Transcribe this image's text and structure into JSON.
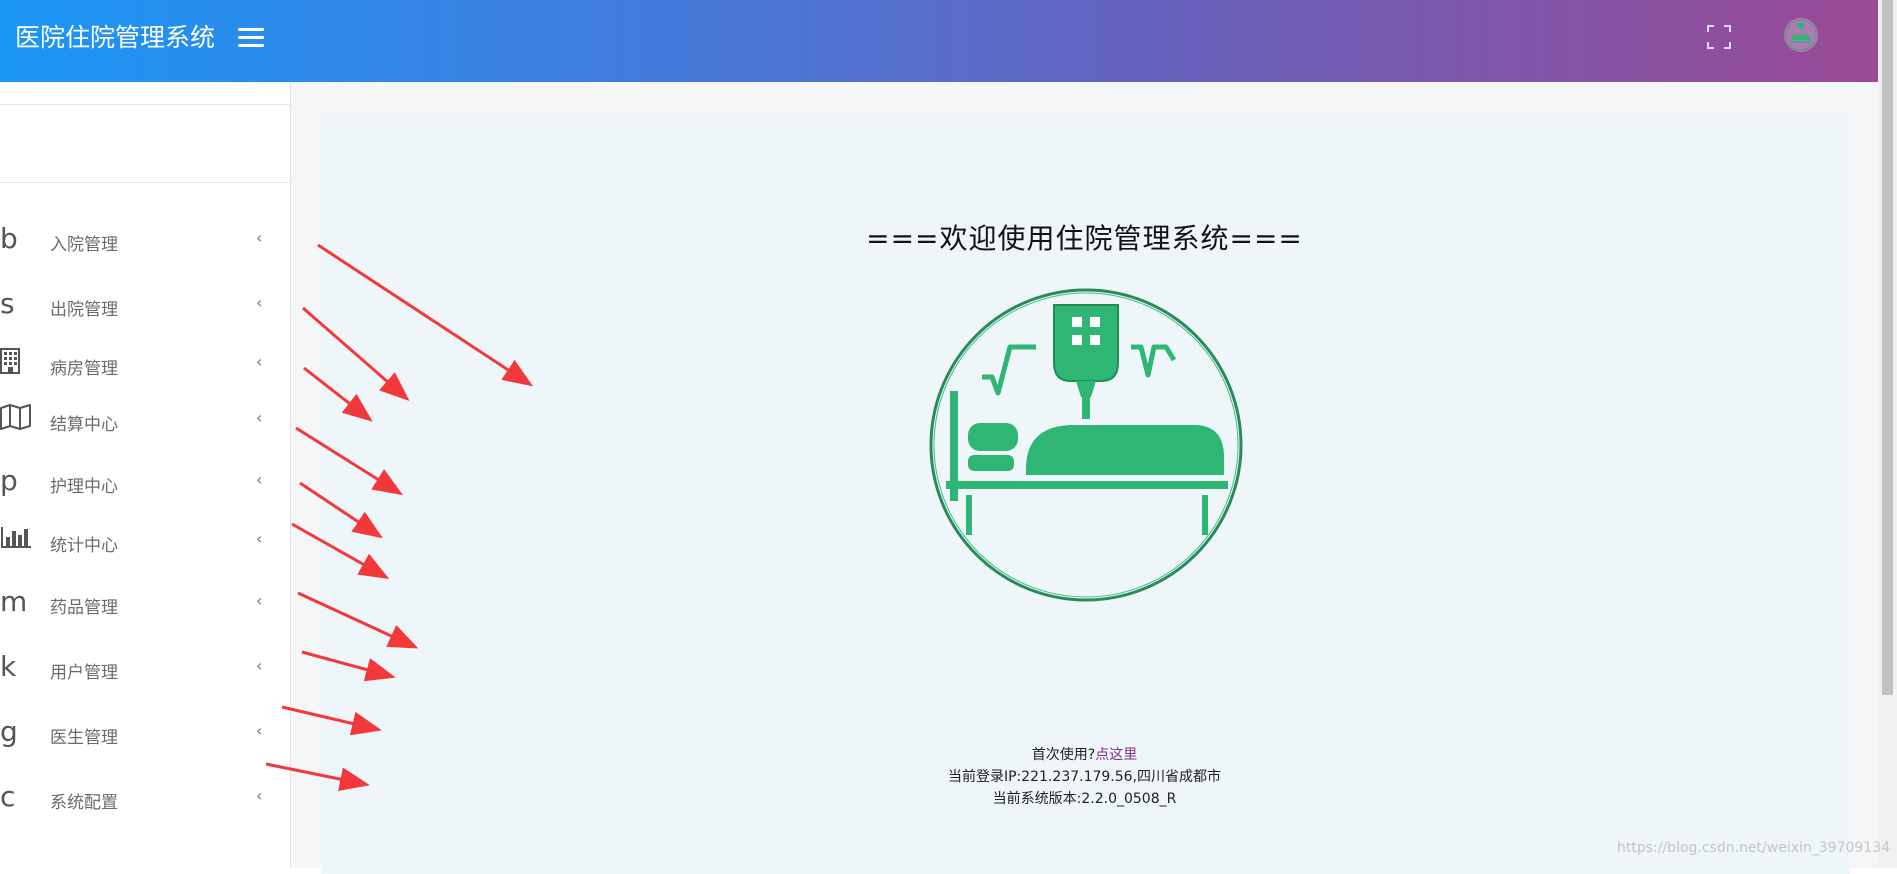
{
  "header": {
    "title": "医院住院管理系统"
  },
  "sidebar": {
    "items": [
      {
        "glyph": "b",
        "label": "入院管理"
      },
      {
        "glyph": "s",
        "label": "出院管理"
      },
      {
        "glyph": "",
        "icon": "building-icon",
        "label": "病房管理"
      },
      {
        "glyph": "",
        "icon": "map-icon",
        "label": "结算中心"
      },
      {
        "glyph": "p",
        "label": "护理中心"
      },
      {
        "glyph": "",
        "icon": "bar-chart-icon",
        "label": "统计中心"
      },
      {
        "glyph": "m",
        "label": "药品管理"
      },
      {
        "glyph": "k",
        "label": "用户管理"
      },
      {
        "glyph": "g",
        "label": "医生管理"
      },
      {
        "glyph": "c",
        "label": "系统配置"
      }
    ],
    "chevron": "‹"
  },
  "main": {
    "welcome": "===欢迎使用住院管理系统===",
    "first_use_prefix": "首次使用?",
    "first_use_link": "点这里",
    "login_ip": "当前登录IP:221.237.179.56,四川省成都市",
    "version": "当前系统版本:2.2.0_0508_R"
  },
  "watermark": "https://blog.csdn.net/weixin_39709134",
  "colors": {
    "accent_green": "#2fb574",
    "annotation_red": "#f2383a",
    "link_purple": "#8a2f8a"
  }
}
